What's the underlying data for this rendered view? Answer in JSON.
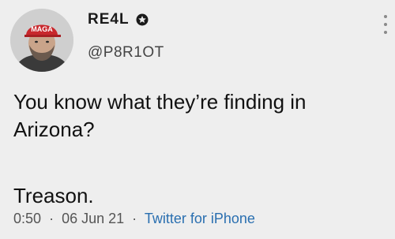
{
  "author": {
    "display_name": "RE4L",
    "handle": "@P8R1OT",
    "avatar_hat_text": "MAGA",
    "badge_icon": "star-badge-icon"
  },
  "tweet": {
    "line1": "You know what they’re finding in",
    "line2": "Arizona?",
    "line3": "Treason."
  },
  "meta": {
    "time": "0:50",
    "date": "06 Jun 21",
    "separator": "·",
    "source": "Twitter for iPhone"
  },
  "colors": {
    "background": "#eeeeee",
    "link": "#2a6fb0",
    "hat": "#c8282d"
  },
  "menu_icon": "more-vertical-icon"
}
